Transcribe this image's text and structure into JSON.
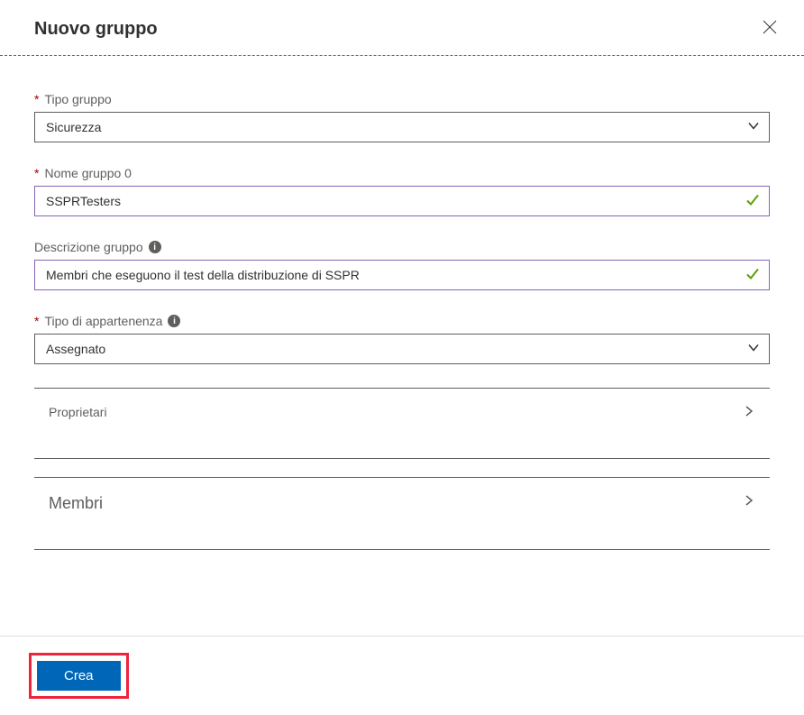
{
  "header": {
    "title": "Nuovo gruppo"
  },
  "fields": {
    "group_type": {
      "label": "Tipo gruppo",
      "value": "Sicurezza"
    },
    "group_name": {
      "label": "Nome gruppo 0",
      "value": "SSPRTesters"
    },
    "group_description": {
      "label": "Descrizione gruppo",
      "value": "Membri che eseguono il test della distribuzione di SSPR"
    },
    "membership_type": {
      "label": "Tipo di appartenenza",
      "value": "Assegnato"
    }
  },
  "sections": {
    "owners": {
      "label": "Proprietari"
    },
    "members": {
      "label": "Membri"
    }
  },
  "actions": {
    "create": "Crea"
  }
}
